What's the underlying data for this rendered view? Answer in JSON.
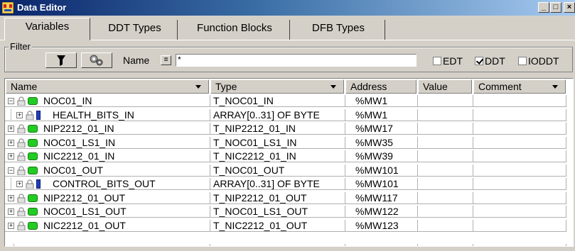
{
  "window": {
    "title": "Data Editor",
    "controls": {
      "minimize": "_",
      "maximize": "□",
      "close": "×"
    }
  },
  "tabs": [
    {
      "label": "Variables",
      "active": true
    },
    {
      "label": "DDT Types"
    },
    {
      "label": "Function Blocks"
    },
    {
      "label": "DFB Types"
    }
  ],
  "filter": {
    "group_label": "Filter",
    "name_label": "Name",
    "eq_label": "=",
    "name_value": "*",
    "checkboxes": [
      {
        "label": "EDT",
        "checked": false
      },
      {
        "label": "DDT",
        "checked": true
      },
      {
        "label": "IODDT",
        "checked": false
      }
    ]
  },
  "columns": [
    "Name",
    "Type",
    "Address",
    "Value",
    "Comment"
  ],
  "rows": [
    {
      "name": "NOC01_IN",
      "type": "T_NOC01_IN",
      "address": "%MW1",
      "expander": "−",
      "icon": "variable"
    },
    {
      "name": "HEALTH_BITS_IN",
      "type": "ARRAY[0..31] OF BYTE",
      "address": "%MW1",
      "expander": "+",
      "icon": "field"
    },
    {
      "name": "NIP2212_01_IN",
      "type": "T_NIP2212_01_IN",
      "address": "%MW17",
      "expander": "+",
      "icon": "variable"
    },
    {
      "name": "NOC01_LS1_IN",
      "type": "T_NOC01_LS1_IN",
      "address": "%MW35",
      "expander": "+",
      "icon": "variable"
    },
    {
      "name": "NIC2212_01_IN",
      "type": "T_NIC2212_01_IN",
      "address": "%MW39",
      "expander": "+",
      "icon": "variable"
    },
    {
      "name": "NOC01_OUT",
      "type": "T_NOC01_OUT",
      "address": "%MW101",
      "expander": "−",
      "icon": "variable"
    },
    {
      "name": "CONTROL_BITS_OUT",
      "type": "ARRAY[0..31] OF BYTE",
      "address": "%MW101",
      "expander": "+",
      "icon": "field"
    },
    {
      "name": "NIP2212_01_OUT",
      "type": "T_NIP2212_01_OUT",
      "address": "%MW117",
      "expander": "+",
      "icon": "variable"
    },
    {
      "name": "NOC01_LS1_OUT",
      "type": "T_NOC01_LS1_OUT",
      "address": "%MW122",
      "expander": "+",
      "icon": "variable"
    },
    {
      "name": "NIC2212_01_OUT",
      "type": "T_NIC2212_01_OUT",
      "address": "%MW123",
      "expander": "+",
      "icon": "variable"
    }
  ]
}
